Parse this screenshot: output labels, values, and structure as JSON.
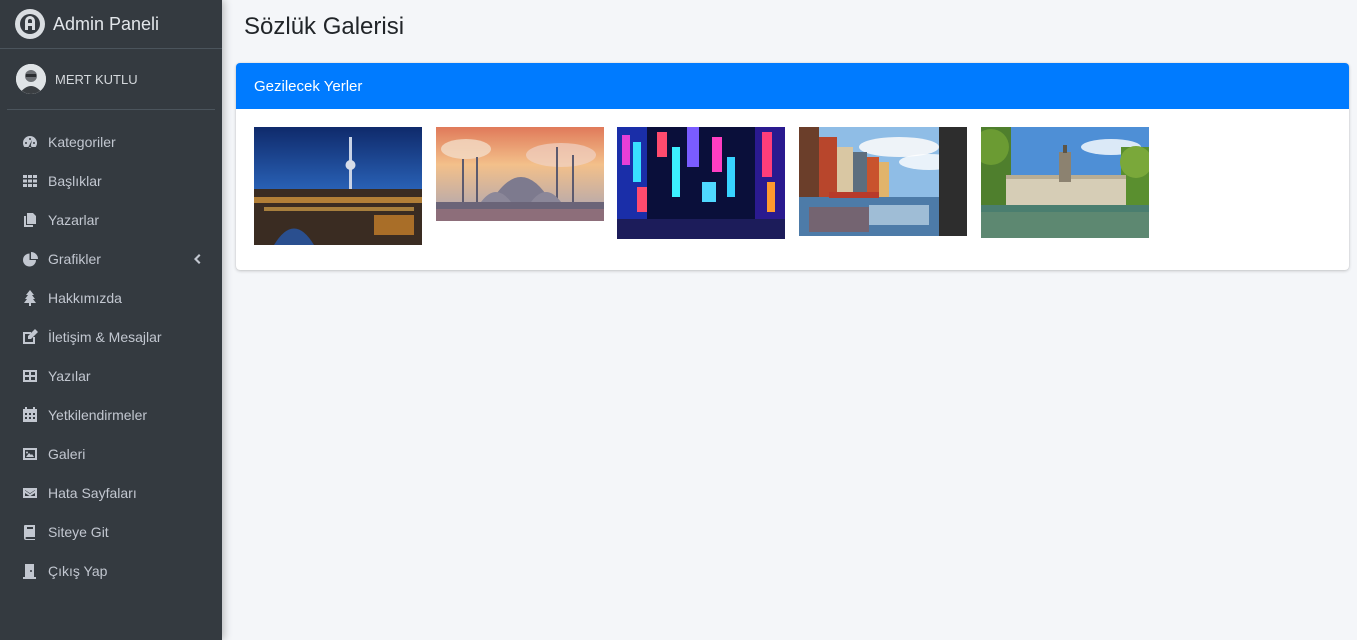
{
  "brand": {
    "title": "Admin Paneli",
    "logo_icon": "admin-logo-icon"
  },
  "user": {
    "name": "MERT KUTLU",
    "avatar_icon": "user-avatar"
  },
  "sidebar": {
    "items": [
      {
        "label": "Kategoriler",
        "icon": "tachometer-icon"
      },
      {
        "label": "Başlıklar",
        "icon": "grid-icon"
      },
      {
        "label": "Yazarlar",
        "icon": "copy-icon"
      },
      {
        "label": "Grafikler",
        "icon": "pie-chart-icon",
        "has_submenu": true
      },
      {
        "label": "Hakkımızda",
        "icon": "tree-icon"
      },
      {
        "label": "İletişim & Mesajlar",
        "icon": "edit-icon"
      },
      {
        "label": "Yazılar",
        "icon": "table-icon"
      },
      {
        "label": "Yetkilendirmeler",
        "icon": "calendar-icon"
      },
      {
        "label": "Galeri",
        "icon": "image-icon"
      },
      {
        "label": "Hata Sayfaları",
        "icon": "envelope-icon"
      },
      {
        "label": "Siteye Git",
        "icon": "book-icon"
      },
      {
        "label": "Çıkış Yap",
        "icon": "door-icon"
      }
    ]
  },
  "page": {
    "title": "Sözlük Galerisi"
  },
  "card": {
    "header": "Gezilecek Yerler",
    "photos": [
      {
        "name": "berlin-night-photo"
      },
      {
        "name": "istanbul-mosque-photo"
      },
      {
        "name": "tokyo-neon-photo"
      },
      {
        "name": "amsterdam-canal-photo"
      },
      {
        "name": "madrid-retiro-photo"
      }
    ]
  },
  "colors": {
    "sidebar_bg": "#343a40",
    "card_header_bg": "#007bff",
    "page_bg": "#f4f6f9",
    "sidebar_text": "#c2c7d0"
  }
}
